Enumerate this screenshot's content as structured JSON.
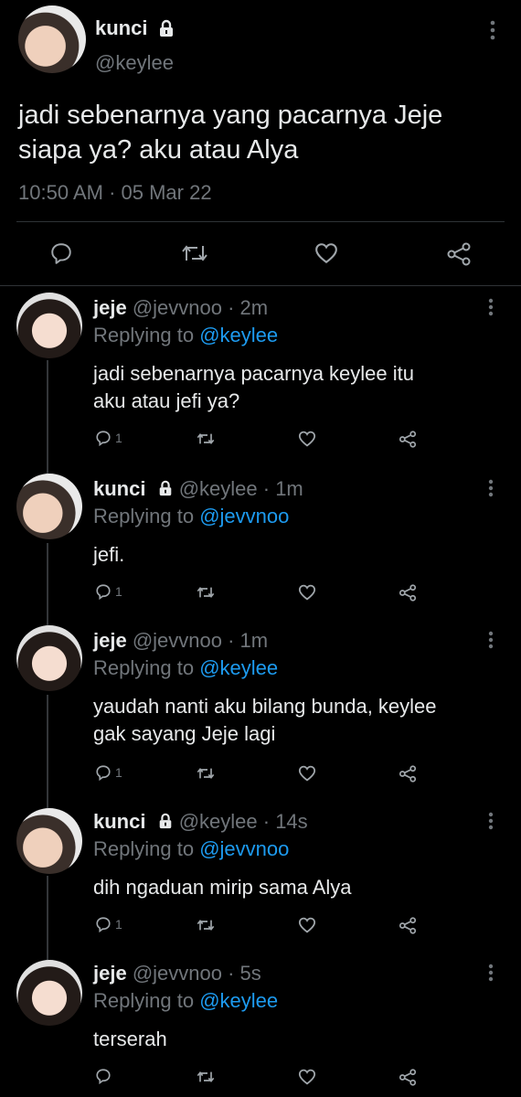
{
  "tweet": {
    "name": "kunci",
    "handle": "@keylee",
    "text_line1": "jadi sebenarnya yang pacarnya Jeje",
    "text_line2": "siapa ya? aku atau Alya",
    "timestamp": "10:50 AM · 05 Mar 22"
  },
  "replies": [
    {
      "name": "jeje",
      "meta": "@jevvnoo · 2m",
      "replying_label": "Replying to",
      "replying_to": "@keylee",
      "line1": "jadi sebenarnya pacarnya keylee itu",
      "line2": "aku atau jefi ya?",
      "reply_count": "1"
    },
    {
      "name": "kunci",
      "meta": "@keylee · 1m",
      "replying_label": "Replying to",
      "replying_to": "@jevvnoo",
      "line1": "jefi.",
      "reply_count": "1"
    },
    {
      "name": "jeje",
      "meta": "@jevvnoo · 1m",
      "replying_label": "Replying to",
      "replying_to": "@keylee",
      "line1": "yaudah nanti aku bilang bunda, keylee",
      "line2": "gak sayang Jeje lagi",
      "reply_count": "1"
    },
    {
      "name": "kunci",
      "meta": "@keylee · 14s",
      "replying_label": "Replying to",
      "replying_to": "@jevvnoo",
      "line1": "dih ngaduan mirip sama Alya",
      "reply_count": "1"
    },
    {
      "name": "jeje",
      "meta": "@jevvnoo · 5s",
      "replying_label": "Replying to",
      "replying_to": "@keylee",
      "line1": "terserah"
    }
  ],
  "icons": {
    "reply": "comment-icon",
    "retweet": "retweet-icon",
    "like": "heart-icon",
    "share": "share-icon",
    "more": "more-vertical-icon",
    "lock": "lock-icon"
  },
  "colors": {
    "background": "#000000",
    "text": "#e7e9ea",
    "secondary": "#71767b",
    "link": "#1d9bf0"
  }
}
